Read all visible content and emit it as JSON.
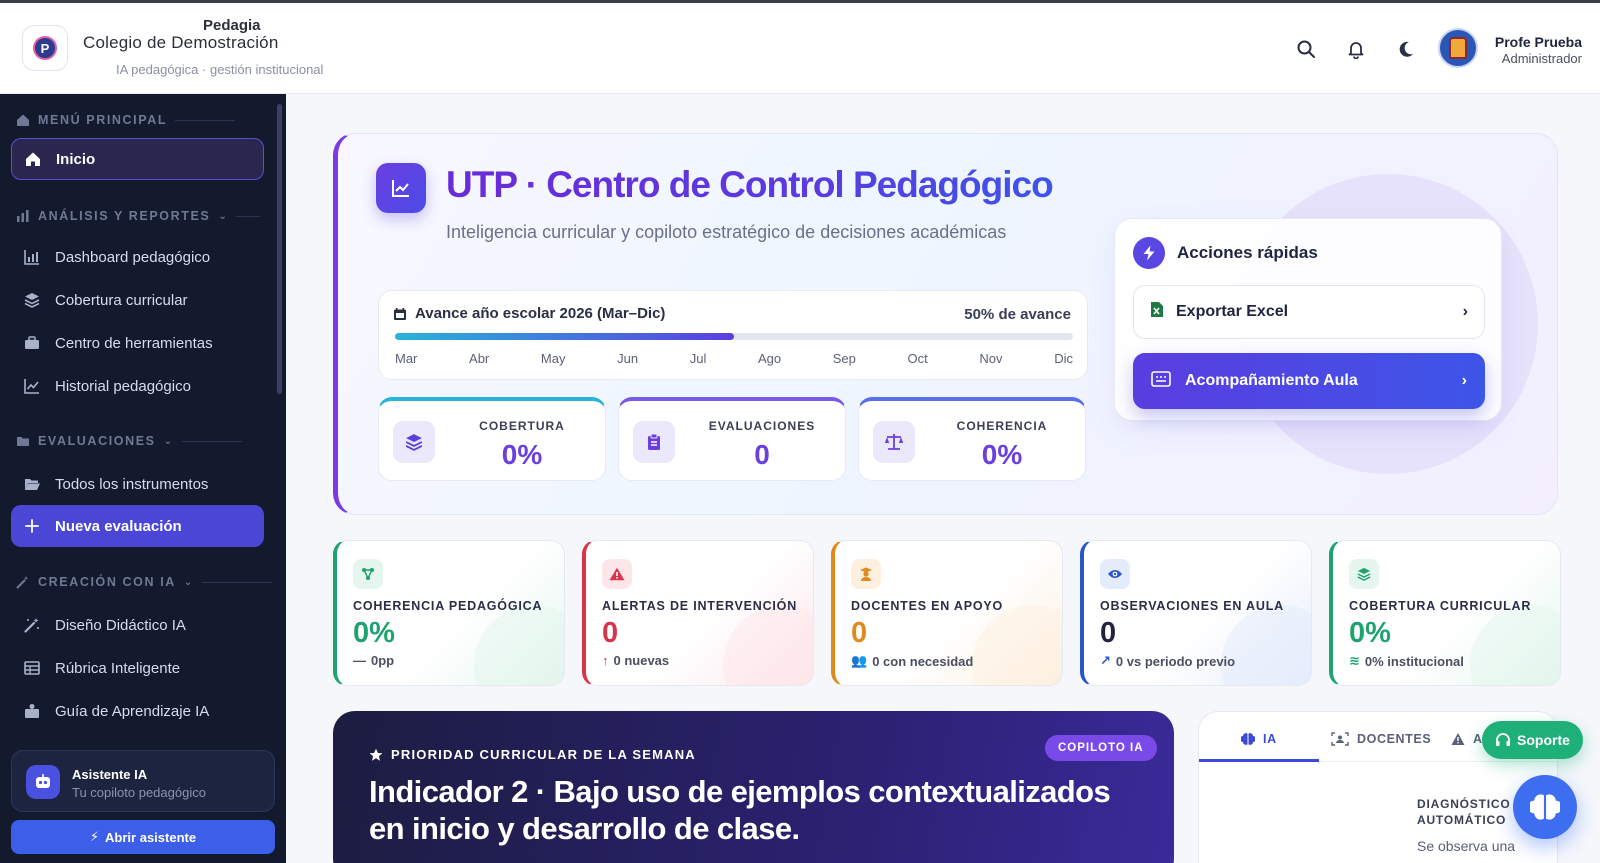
{
  "header": {
    "brand_top": "Pedagia",
    "brand_name": "Colegio de Demostración",
    "brand_sub": "IA pedagógica · gestión institucional",
    "logo_letter": "P",
    "user_name": "Profe Prueba",
    "user_role": "Administrador"
  },
  "sidebar": {
    "section_main": "MENÚ PRINCIPAL",
    "home": "Inicio",
    "section_reports": "ANÁLISIS Y REPORTES",
    "reports": [
      "Dashboard pedagógico",
      "Cobertura curricular",
      "Centro de herramientas",
      "Historial pedagógico"
    ],
    "section_evals": "EVALUACIONES",
    "all_instruments": "Todos los instrumentos",
    "new_eval": "Nueva evaluación",
    "section_ai": "CREACIÓN CON IA",
    "ai_items": [
      "Diseño Didáctico IA",
      "Rúbrica Inteligente",
      "Guía de Aprendizaje IA"
    ],
    "assistant_title": "Asistente IA",
    "assistant_sub": "Tu copiloto pedagógico",
    "assistant_button": "Abrir asistente"
  },
  "hero": {
    "title": "UTP · Centro de Control Pedagógico",
    "subtitle": "Inteligencia curricular y copiloto estratégico de decisiones académicas",
    "year_title": "Avance año escolar 2026 (Mar–Dic)",
    "year_pct_text": "50% de avance",
    "year_progress": 0.5,
    "months": [
      "Mar",
      "Abr",
      "May",
      "Jun",
      "Jul",
      "Ago",
      "Sep",
      "Oct",
      "Nov",
      "Dic"
    ],
    "kpis": [
      {
        "label": "COBERTURA",
        "value": "0%"
      },
      {
        "label": "EVALUACIONES",
        "value": "0"
      },
      {
        "label": "COHERENCIA",
        "value": "0%"
      }
    ],
    "quick_title": "Acciones rápidas",
    "quick_export": "Exportar Excel",
    "quick_classroom": "Acompañamiento Aula"
  },
  "metrics": [
    {
      "label": "COHERENCIA PEDAGÓGICA",
      "value": "0%",
      "sub": "0pp",
      "color": "#1fa36e"
    },
    {
      "label": "ALERTAS DE INTERVENCIÓN",
      "value": "0",
      "sub": "0 nuevas",
      "color": "#d8344a"
    },
    {
      "label": "DOCENTES EN APOYO",
      "value": "0",
      "sub": "0 con necesidad",
      "color": "#e08a1e"
    },
    {
      "label": "OBSERVACIONES EN AULA",
      "value": "0",
      "sub": "0 vs periodo previo",
      "color": "#2a56c8"
    },
    {
      "label": "COBERTURA CURRICULAR",
      "value": "0%",
      "sub": "0% institucional",
      "color": "#1fa36e"
    }
  ],
  "priority": {
    "tag": "PRIORIDAD CURRICULAR DE LA SEMANA",
    "badge": "COPILOTO IA",
    "title": "Indicador 2 · Bajo uso de ejemplos contextualizados en inicio y desarrollo de clase."
  },
  "tabs": {
    "items": [
      "IA",
      "DOCENTES",
      "A"
    ],
    "diag_label_1": "DIAGNÓSTICO",
    "diag_label_2": "AUTOMÁTICO",
    "diag_text": "Se observa una"
  },
  "support_label": "Soporte"
}
